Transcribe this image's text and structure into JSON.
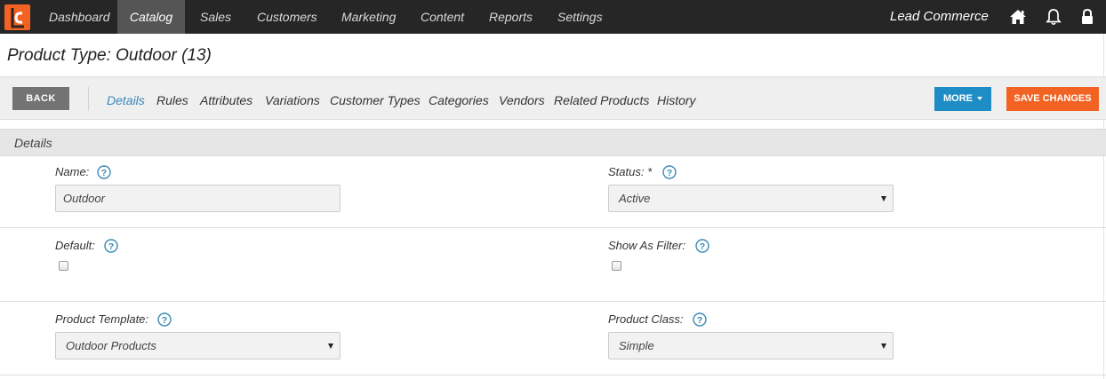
{
  "nav": {
    "items": [
      {
        "label": "Dashboard",
        "active": false
      },
      {
        "label": "Catalog",
        "active": true
      },
      {
        "label": "Sales",
        "active": false
      },
      {
        "label": "Customers",
        "active": false
      },
      {
        "label": "Marketing",
        "active": false
      },
      {
        "label": "Content",
        "active": false
      },
      {
        "label": "Reports",
        "active": false
      },
      {
        "label": "Settings",
        "active": false
      }
    ],
    "brand": "Lead Commerce",
    "icons": [
      "home-icon",
      "bell-icon",
      "lock-icon"
    ],
    "logo_color": "#f26222"
  },
  "page": {
    "title": "Product Type: Outdoor (13)"
  },
  "toolbar": {
    "back_label": "BACK",
    "tabs": [
      {
        "label": "Details",
        "active": true
      },
      {
        "label": "Rules"
      },
      {
        "label": "Attributes"
      },
      {
        "label": "Variations"
      },
      {
        "label": "Customer Types"
      },
      {
        "label": "Categories"
      },
      {
        "label": "Vendors"
      },
      {
        "label": "Related Products"
      },
      {
        "label": "History"
      }
    ],
    "more_label": "MORE",
    "save_label": "SAVE CHANGES"
  },
  "section": {
    "title": "Details"
  },
  "form": {
    "name": {
      "label": "Name:",
      "value": "Outdoor"
    },
    "status": {
      "label": "Status: *",
      "value": "Active"
    },
    "default": {
      "label": "Default:",
      "checked": false
    },
    "show_as_filter": {
      "label": "Show As Filter:",
      "checked": false
    },
    "product_template": {
      "label": "Product Template:",
      "value": "Outdoor Products"
    },
    "product_class": {
      "label": "Product Class:",
      "value": "Simple"
    }
  },
  "colors": {
    "nav_bg": "#262626",
    "accent_blue": "#1f8dc5",
    "accent_orange": "#f26222",
    "active_tab": "#3a87b8"
  }
}
